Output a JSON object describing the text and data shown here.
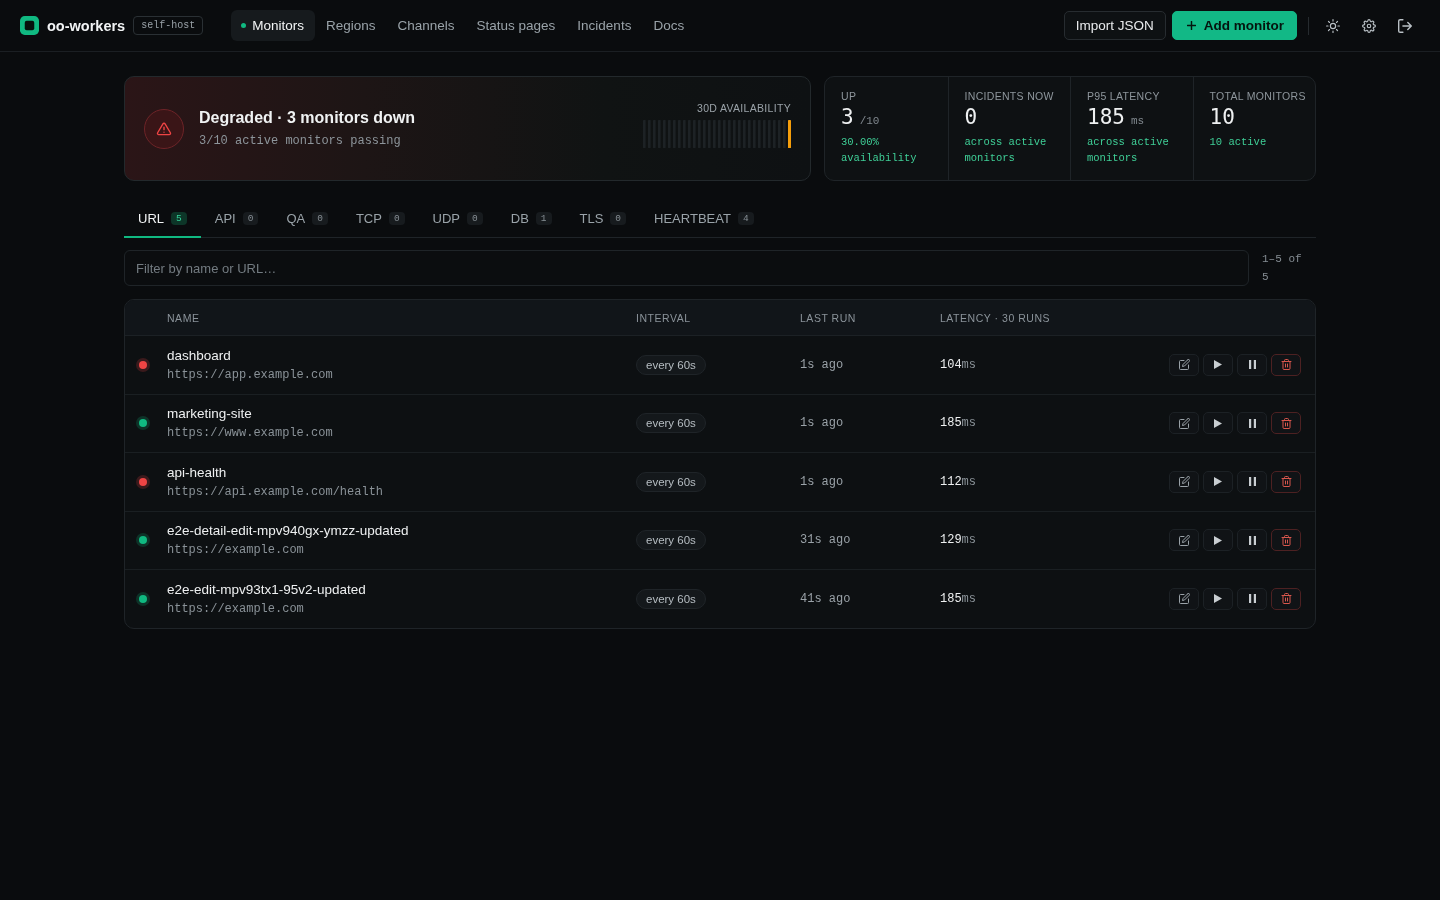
{
  "topbar": {
    "brand": "oo-workers",
    "badge": "self-host",
    "nav": [
      {
        "label": "Monitors",
        "selected": true
      },
      {
        "label": "Regions",
        "selected": false
      },
      {
        "label": "Channels",
        "selected": false
      },
      {
        "label": "Status pages",
        "selected": false
      },
      {
        "label": "Incidents",
        "selected": false
      },
      {
        "label": "Docs",
        "selected": false
      }
    ],
    "buttons": [
      {
        "label": "Import JSON",
        "kind": "secondary"
      },
      {
        "label": "Add monitor",
        "kind": "primary"
      }
    ]
  },
  "banner": {
    "degraded": true,
    "title": "Degraded · 3 monitors down",
    "subtitle": "3/10 active monitors passing",
    "chart_label": "30D AVAILABILITY"
  },
  "stats": [
    {
      "label": "UP",
      "value": "3",
      "unit": "/10",
      "note": "30.00% availability"
    },
    {
      "label": "INCIDENTS NOW",
      "value": "0",
      "note": "across active monitors"
    },
    {
      "label": "P95 LATENCY",
      "value": "185",
      "unit": "ms",
      "note": "across active monitors"
    },
    {
      "label": "TOTAL MONITORS",
      "value": "10",
      "note": "10 active"
    }
  ],
  "tabs": [
    {
      "label": "URL",
      "count": "5",
      "selected": true
    },
    {
      "label": "API",
      "count": "0",
      "selected": false
    },
    {
      "label": "QA",
      "count": "0",
      "selected": false
    },
    {
      "label": "TCP",
      "count": "0",
      "selected": false
    },
    {
      "label": "UDP",
      "count": "0",
      "selected": false
    },
    {
      "label": "DB",
      "count": "1",
      "selected": false
    },
    {
      "label": "TLS",
      "count": "0",
      "selected": false
    },
    {
      "label": "HEARTBEAT",
      "count": "4",
      "selected": false
    }
  ],
  "filter": {
    "placeholder": "Filter by name or URL…"
  },
  "pagination": "1–5 of 5",
  "table": {
    "columns": [
      "NAME",
      "INTERVAL",
      "LAST RUN",
      "LATENCY · 30 RUNS"
    ],
    "rows": [
      {
        "color": "#ef4444",
        "name": "dashboard",
        "url": "https://app.example.com",
        "interval": "every 60s",
        "last_run": "1s ago",
        "latency": "104",
        "latency_unit": "ms"
      },
      {
        "color": "#10b981",
        "name": "marketing-site",
        "url": "https://www.example.com",
        "interval": "every 60s",
        "last_run": "1s ago",
        "latency": "185",
        "latency_unit": "ms"
      },
      {
        "color": "#ef4444",
        "name": "api-health",
        "url": "https://api.example.com/health",
        "interval": "every 60s",
        "last_run": "1s ago",
        "latency": "112",
        "latency_unit": "ms"
      },
      {
        "color": "#10b981",
        "name": "e2e-detail-edit-mpv940gx-ymzz-updated",
        "url": "https://example.com",
        "interval": "every 60s",
        "last_run": "31s ago",
        "latency": "129",
        "latency_unit": "ms"
      },
      {
        "color": "#10b981",
        "name": "e2e-edit-mpv93tx1-95v2-updated",
        "url": "https://example.com",
        "interval": "every 60s",
        "last_run": "41s ago",
        "latency": "185",
        "latency_unit": "ms"
      }
    ]
  }
}
